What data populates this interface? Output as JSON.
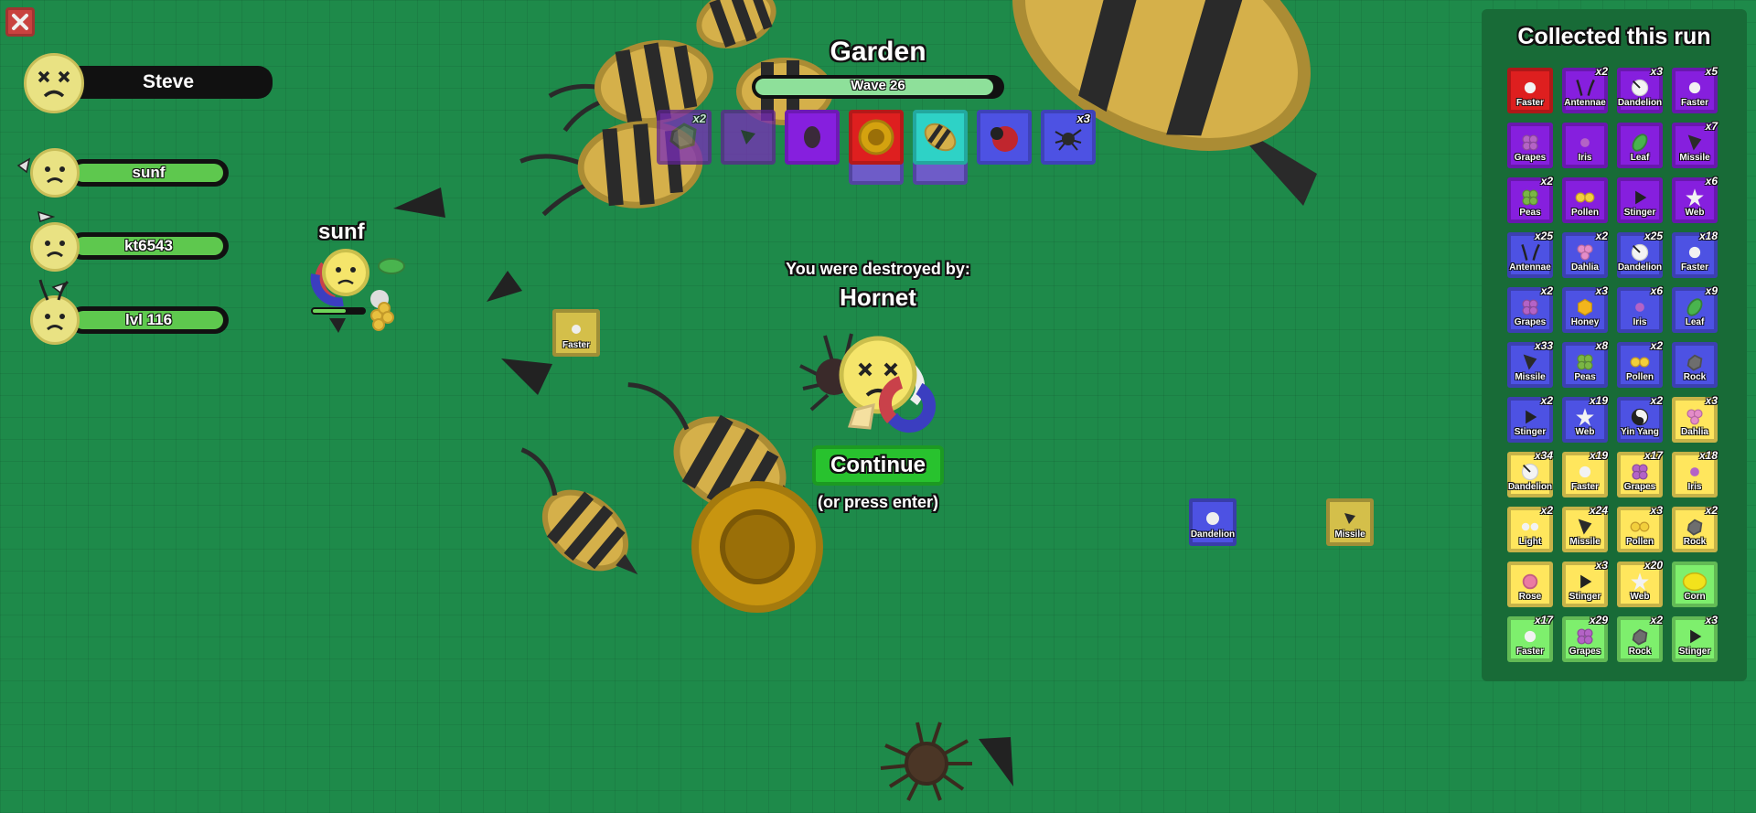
{
  "zone": {
    "name": "Garden",
    "wave_label": "Wave 26",
    "wave_progress": 0.97
  },
  "player": {
    "name": "Steve",
    "status": "dead"
  },
  "squad": [
    {
      "name": "sunf",
      "health": 1.0
    },
    {
      "name": "kt6543",
      "health": 1.0
    },
    {
      "name": "lvl 116",
      "health": 1.0
    }
  ],
  "world_player_label": "sunf",
  "loadout": [
    {
      "icon": "rock-icon",
      "rarity": "epic",
      "count": "x2"
    },
    {
      "icon": "missile-icon",
      "rarity": "epic",
      "count": ""
    },
    {
      "icon": "pincer-icon",
      "rarity": "epic",
      "count": ""
    },
    {
      "icon": "sunflower-icon",
      "rarity": "mythic",
      "count": ""
    },
    {
      "icon": "bee-icon",
      "rarity": "ultra",
      "count": ""
    },
    {
      "icon": "ladybug-icon",
      "rarity": "rare",
      "count": ""
    },
    {
      "icon": "spider-icon",
      "rarity": "rare",
      "count": "x3"
    }
  ],
  "death": {
    "message": "You were destroyed by:",
    "killer": "Hornet",
    "continue_label": "Continue",
    "hint": "(or press enter)"
  },
  "ground_drops": [
    {
      "label": "Faster",
      "rarity": "legendary"
    },
    {
      "label": "Dandelion",
      "rarity": "rare"
    },
    {
      "label": "Missile",
      "rarity": "legendary"
    }
  ],
  "rarity_colors": {
    "common": "#7eef6d",
    "unusual": "#ffe65d",
    "rare": "#4d52e3",
    "epic": "#861fde",
    "legendary": "#de1f1f",
    "mythic": "#de1f1f",
    "ultra": "#2ed2c6"
  },
  "collected": {
    "title": "Collected this run",
    "items": [
      {
        "label": "Faster",
        "count": "",
        "rarity": "legendary",
        "icon": "faster"
      },
      {
        "label": "Antennae",
        "count": "x2",
        "rarity": "epic",
        "icon": "antennae"
      },
      {
        "label": "Dandelion",
        "count": "x3",
        "rarity": "epic",
        "icon": "dandelion"
      },
      {
        "label": "Faster",
        "count": "x5",
        "rarity": "epic",
        "icon": "faster"
      },
      {
        "label": "Grapes",
        "count": "",
        "rarity": "epic",
        "icon": "grapes"
      },
      {
        "label": "Iris",
        "count": "",
        "rarity": "epic",
        "icon": "iris"
      },
      {
        "label": "Leaf",
        "count": "",
        "rarity": "epic",
        "icon": "leaf"
      },
      {
        "label": "Missile",
        "count": "x7",
        "rarity": "epic",
        "icon": "missile"
      },
      {
        "label": "Peas",
        "count": "x2",
        "rarity": "epic",
        "icon": "peas"
      },
      {
        "label": "Pollen",
        "count": "",
        "rarity": "epic",
        "icon": "pollen"
      },
      {
        "label": "Stinger",
        "count": "",
        "rarity": "epic",
        "icon": "stinger"
      },
      {
        "label": "Web",
        "count": "x6",
        "rarity": "epic",
        "icon": "web"
      },
      {
        "label": "Antennae",
        "count": "x25",
        "rarity": "rare",
        "icon": "antennae"
      },
      {
        "label": "Dahlia",
        "count": "x2",
        "rarity": "rare",
        "icon": "dahlia"
      },
      {
        "label": "Dandelion",
        "count": "x25",
        "rarity": "rare",
        "icon": "dandelion"
      },
      {
        "label": "Faster",
        "count": "x18",
        "rarity": "rare",
        "icon": "faster"
      },
      {
        "label": "Grapes",
        "count": "x2",
        "rarity": "rare",
        "icon": "grapes"
      },
      {
        "label": "Honey",
        "count": "x3",
        "rarity": "rare",
        "icon": "honey"
      },
      {
        "label": "Iris",
        "count": "x6",
        "rarity": "rare",
        "icon": "iris"
      },
      {
        "label": "Leaf",
        "count": "x9",
        "rarity": "rare",
        "icon": "leaf"
      },
      {
        "label": "Missile",
        "count": "x33",
        "rarity": "rare",
        "icon": "missile"
      },
      {
        "label": "Peas",
        "count": "x8",
        "rarity": "rare",
        "icon": "peas"
      },
      {
        "label": "Pollen",
        "count": "x2",
        "rarity": "rare",
        "icon": "pollen"
      },
      {
        "label": "Rock",
        "count": "",
        "rarity": "rare",
        "icon": "rock"
      },
      {
        "label": "Stinger",
        "count": "x2",
        "rarity": "rare",
        "icon": "stinger"
      },
      {
        "label": "Web",
        "count": "x19",
        "rarity": "rare",
        "icon": "web"
      },
      {
        "label": "Yin Yang",
        "count": "x2",
        "rarity": "rare",
        "icon": "yinyang"
      },
      {
        "label": "Dahlia",
        "count": "x3",
        "rarity": "unusual",
        "icon": "dahlia"
      },
      {
        "label": "Dandelion",
        "count": "x34",
        "rarity": "unusual",
        "icon": "dandelion"
      },
      {
        "label": "Faster",
        "count": "x19",
        "rarity": "unusual",
        "icon": "faster"
      },
      {
        "label": "Grapes",
        "count": "x17",
        "rarity": "unusual",
        "icon": "grapes"
      },
      {
        "label": "Iris",
        "count": "x18",
        "rarity": "unusual",
        "icon": "iris"
      },
      {
        "label": "Light",
        "count": "x2",
        "rarity": "unusual",
        "icon": "light"
      },
      {
        "label": "Missile",
        "count": "x24",
        "rarity": "unusual",
        "icon": "missile"
      },
      {
        "label": "Pollen",
        "count": "x3",
        "rarity": "unusual",
        "icon": "pollen"
      },
      {
        "label": "Rock",
        "count": "x2",
        "rarity": "unusual",
        "icon": "rock"
      },
      {
        "label": "Rose",
        "count": "",
        "rarity": "unusual",
        "icon": "rose"
      },
      {
        "label": "Stinger",
        "count": "x3",
        "rarity": "unusual",
        "icon": "stinger"
      },
      {
        "label": "Web",
        "count": "x20",
        "rarity": "unusual",
        "icon": "web"
      },
      {
        "label": "Corn",
        "count": "",
        "rarity": "common",
        "icon": "corn"
      },
      {
        "label": "Faster",
        "count": "x17",
        "rarity": "common",
        "icon": "faster"
      },
      {
        "label": "Grapes",
        "count": "x29",
        "rarity": "common",
        "icon": "grapes"
      },
      {
        "label": "Rock",
        "count": "x2",
        "rarity": "common",
        "icon": "rock"
      },
      {
        "label": "Stinger",
        "count": "x3",
        "rarity": "common",
        "icon": "stinger"
      }
    ]
  }
}
